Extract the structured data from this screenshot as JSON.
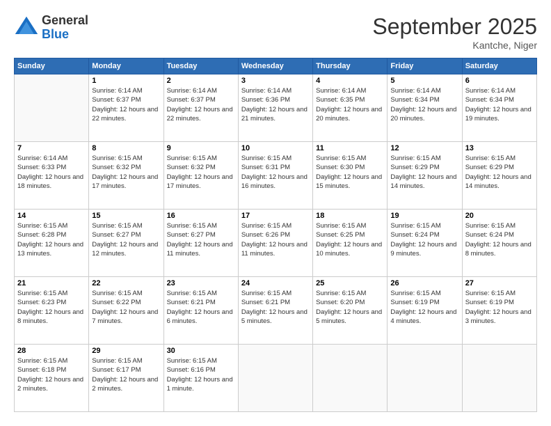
{
  "logo": {
    "general": "General",
    "blue": "Blue"
  },
  "header": {
    "month": "September 2025",
    "location": "Kantche, Niger"
  },
  "days_of_week": [
    "Sunday",
    "Monday",
    "Tuesday",
    "Wednesday",
    "Thursday",
    "Friday",
    "Saturday"
  ],
  "weeks": [
    [
      {
        "day": "",
        "sunrise": "",
        "sunset": "",
        "daylight": ""
      },
      {
        "day": "1",
        "sunrise": "Sunrise: 6:14 AM",
        "sunset": "Sunset: 6:37 PM",
        "daylight": "Daylight: 12 hours and 22 minutes."
      },
      {
        "day": "2",
        "sunrise": "Sunrise: 6:14 AM",
        "sunset": "Sunset: 6:37 PM",
        "daylight": "Daylight: 12 hours and 22 minutes."
      },
      {
        "day": "3",
        "sunrise": "Sunrise: 6:14 AM",
        "sunset": "Sunset: 6:36 PM",
        "daylight": "Daylight: 12 hours and 21 minutes."
      },
      {
        "day": "4",
        "sunrise": "Sunrise: 6:14 AM",
        "sunset": "Sunset: 6:35 PM",
        "daylight": "Daylight: 12 hours and 20 minutes."
      },
      {
        "day": "5",
        "sunrise": "Sunrise: 6:14 AM",
        "sunset": "Sunset: 6:34 PM",
        "daylight": "Daylight: 12 hours and 20 minutes."
      },
      {
        "day": "6",
        "sunrise": "Sunrise: 6:14 AM",
        "sunset": "Sunset: 6:34 PM",
        "daylight": "Daylight: 12 hours and 19 minutes."
      }
    ],
    [
      {
        "day": "7",
        "sunrise": "Sunrise: 6:14 AM",
        "sunset": "Sunset: 6:33 PM",
        "daylight": "Daylight: 12 hours and 18 minutes."
      },
      {
        "day": "8",
        "sunrise": "Sunrise: 6:15 AM",
        "sunset": "Sunset: 6:32 PM",
        "daylight": "Daylight: 12 hours and 17 minutes."
      },
      {
        "day": "9",
        "sunrise": "Sunrise: 6:15 AM",
        "sunset": "Sunset: 6:32 PM",
        "daylight": "Daylight: 12 hours and 17 minutes."
      },
      {
        "day": "10",
        "sunrise": "Sunrise: 6:15 AM",
        "sunset": "Sunset: 6:31 PM",
        "daylight": "Daylight: 12 hours and 16 minutes."
      },
      {
        "day": "11",
        "sunrise": "Sunrise: 6:15 AM",
        "sunset": "Sunset: 6:30 PM",
        "daylight": "Daylight: 12 hours and 15 minutes."
      },
      {
        "day": "12",
        "sunrise": "Sunrise: 6:15 AM",
        "sunset": "Sunset: 6:29 PM",
        "daylight": "Daylight: 12 hours and 14 minutes."
      },
      {
        "day": "13",
        "sunrise": "Sunrise: 6:15 AM",
        "sunset": "Sunset: 6:29 PM",
        "daylight": "Daylight: 12 hours and 14 minutes."
      }
    ],
    [
      {
        "day": "14",
        "sunrise": "Sunrise: 6:15 AM",
        "sunset": "Sunset: 6:28 PM",
        "daylight": "Daylight: 12 hours and 13 minutes."
      },
      {
        "day": "15",
        "sunrise": "Sunrise: 6:15 AM",
        "sunset": "Sunset: 6:27 PM",
        "daylight": "Daylight: 12 hours and 12 minutes."
      },
      {
        "day": "16",
        "sunrise": "Sunrise: 6:15 AM",
        "sunset": "Sunset: 6:27 PM",
        "daylight": "Daylight: 12 hours and 11 minutes."
      },
      {
        "day": "17",
        "sunrise": "Sunrise: 6:15 AM",
        "sunset": "Sunset: 6:26 PM",
        "daylight": "Daylight: 12 hours and 11 minutes."
      },
      {
        "day": "18",
        "sunrise": "Sunrise: 6:15 AM",
        "sunset": "Sunset: 6:25 PM",
        "daylight": "Daylight: 12 hours and 10 minutes."
      },
      {
        "day": "19",
        "sunrise": "Sunrise: 6:15 AM",
        "sunset": "Sunset: 6:24 PM",
        "daylight": "Daylight: 12 hours and 9 minutes."
      },
      {
        "day": "20",
        "sunrise": "Sunrise: 6:15 AM",
        "sunset": "Sunset: 6:24 PM",
        "daylight": "Daylight: 12 hours and 8 minutes."
      }
    ],
    [
      {
        "day": "21",
        "sunrise": "Sunrise: 6:15 AM",
        "sunset": "Sunset: 6:23 PM",
        "daylight": "Daylight: 12 hours and 8 minutes."
      },
      {
        "day": "22",
        "sunrise": "Sunrise: 6:15 AM",
        "sunset": "Sunset: 6:22 PM",
        "daylight": "Daylight: 12 hours and 7 minutes."
      },
      {
        "day": "23",
        "sunrise": "Sunrise: 6:15 AM",
        "sunset": "Sunset: 6:21 PM",
        "daylight": "Daylight: 12 hours and 6 minutes."
      },
      {
        "day": "24",
        "sunrise": "Sunrise: 6:15 AM",
        "sunset": "Sunset: 6:21 PM",
        "daylight": "Daylight: 12 hours and 5 minutes."
      },
      {
        "day": "25",
        "sunrise": "Sunrise: 6:15 AM",
        "sunset": "Sunset: 6:20 PM",
        "daylight": "Daylight: 12 hours and 5 minutes."
      },
      {
        "day": "26",
        "sunrise": "Sunrise: 6:15 AM",
        "sunset": "Sunset: 6:19 PM",
        "daylight": "Daylight: 12 hours and 4 minutes."
      },
      {
        "day": "27",
        "sunrise": "Sunrise: 6:15 AM",
        "sunset": "Sunset: 6:19 PM",
        "daylight": "Daylight: 12 hours and 3 minutes."
      }
    ],
    [
      {
        "day": "28",
        "sunrise": "Sunrise: 6:15 AM",
        "sunset": "Sunset: 6:18 PM",
        "daylight": "Daylight: 12 hours and 2 minutes."
      },
      {
        "day": "29",
        "sunrise": "Sunrise: 6:15 AM",
        "sunset": "Sunset: 6:17 PM",
        "daylight": "Daylight: 12 hours and 2 minutes."
      },
      {
        "day": "30",
        "sunrise": "Sunrise: 6:15 AM",
        "sunset": "Sunset: 6:16 PM",
        "daylight": "Daylight: 12 hours and 1 minute."
      },
      {
        "day": "",
        "sunrise": "",
        "sunset": "",
        "daylight": ""
      },
      {
        "day": "",
        "sunrise": "",
        "sunset": "",
        "daylight": ""
      },
      {
        "day": "",
        "sunrise": "",
        "sunset": "",
        "daylight": ""
      },
      {
        "day": "",
        "sunrise": "",
        "sunset": "",
        "daylight": ""
      }
    ]
  ]
}
